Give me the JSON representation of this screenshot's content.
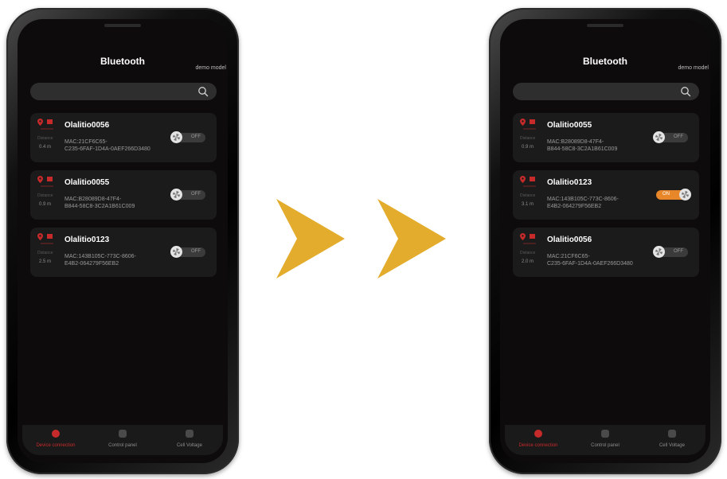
{
  "colors": {
    "accent_red": "#c62a2a",
    "toggle_on": "#e8862a",
    "arrow": "#e3ac2c",
    "screen_bg": "#0d0b0b",
    "card_bg": "#1c1b1b"
  },
  "icons": [
    "search-icon",
    "location-pin-icon",
    "flag-icon",
    "knob-icon",
    "chevron-right-arrow"
  ],
  "phones": [
    {
      "title": "Bluetooth",
      "demo_label": "demo model",
      "search": {
        "value": ""
      },
      "devices": [
        {
          "name": "Olalitio0056",
          "distance_label": "Distance",
          "distance": "0.4 m",
          "mac_line1": "MAC:21CF6C65-",
          "mac_line2": "C235-6FAF-1D4A-0AEF266D3480",
          "toggle": "OFF",
          "on": false
        },
        {
          "name": "Olalitio0055",
          "distance_label": "Distance",
          "distance": "0.9 m",
          "mac_line1": "MAC:B28089D8-47F4-",
          "mac_line2": "B844-58C8-3C2A1B61C009",
          "toggle": "OFF",
          "on": false
        },
        {
          "name": "Olalitio0123",
          "distance_label": "Distance",
          "distance": "2.5 m",
          "mac_line1": "MAC:143B105C-773C-8606-",
          "mac_line2": "E4B2-064279F56EB2",
          "toggle": "OFF",
          "on": false
        }
      ],
      "tabs": [
        {
          "label": "Device connection",
          "active": true
        },
        {
          "label": "Control panel",
          "active": false
        },
        {
          "label": "Cell Voltage",
          "active": false
        }
      ]
    },
    {
      "title": "Bluetooth",
      "demo_label": "demo model",
      "search": {
        "value": ""
      },
      "devices": [
        {
          "name": "Olalitio0055",
          "distance_label": "Distance",
          "distance": "0.9 m",
          "mac_line1": "MAC:B28089D8-47F4-",
          "mac_line2": "B844-58C8-3C2A1B61C009",
          "toggle": "OFF",
          "on": false
        },
        {
          "name": "Olalitio0123",
          "distance_label": "Distance",
          "distance": "3.1 m",
          "mac_line1": "MAC:143B105C-773C-8606-",
          "mac_line2": "E4B2-064279F56EB2",
          "toggle": "ON",
          "on": true
        },
        {
          "name": "Olalitio0056",
          "distance_label": "Distance",
          "distance": "2.0 m",
          "mac_line1": "MAC:21CF6C65-",
          "mac_line2": "C235-6FAF-1D4A-0AEF266D3480",
          "toggle": "OFF",
          "on": false
        }
      ],
      "tabs": [
        {
          "label": "Device connection",
          "active": true
        },
        {
          "label": "Control panel",
          "active": false
        },
        {
          "label": "Cell Voltage",
          "active": false
        }
      ]
    }
  ]
}
